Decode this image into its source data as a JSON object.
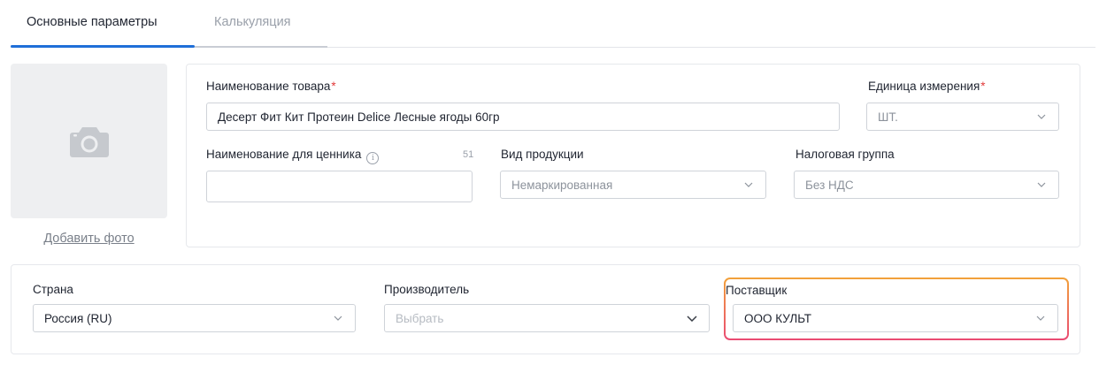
{
  "tabs": [
    {
      "label": "Основные параметры"
    },
    {
      "label": "Калькуляция"
    }
  ],
  "photo": {
    "add_label": "Добавить фото",
    "icon": "camera-icon"
  },
  "product": {
    "name_label": "Наименование товара",
    "name_value": "Десерт Фит Кит Протеин Delice Лесные ягоды 60гр",
    "unit_label": "Единица измерения",
    "unit_value": "ШТ.",
    "price_tag_label": "Наименование для ценника",
    "price_tag_counter": "51",
    "price_tag_value": "",
    "kind_label": "Вид продукции",
    "kind_value": "Немаркированная",
    "tax_label": "Налоговая группа",
    "tax_value": "Без НДС",
    "required_mark": "*"
  },
  "origin": {
    "country_label": "Страна",
    "country_value": "Россия (RU)",
    "manufacturer_label": "Производитель",
    "manufacturer_placeholder": "Выбрать",
    "supplier_label": "Поставщик",
    "supplier_value": "ООО КУЛЬТ"
  },
  "colors": {
    "accent": "#1f6fd8",
    "required": "#e23b3b",
    "highlight_top": "#f2a23a",
    "highlight_bottom": "#ea4a73"
  }
}
